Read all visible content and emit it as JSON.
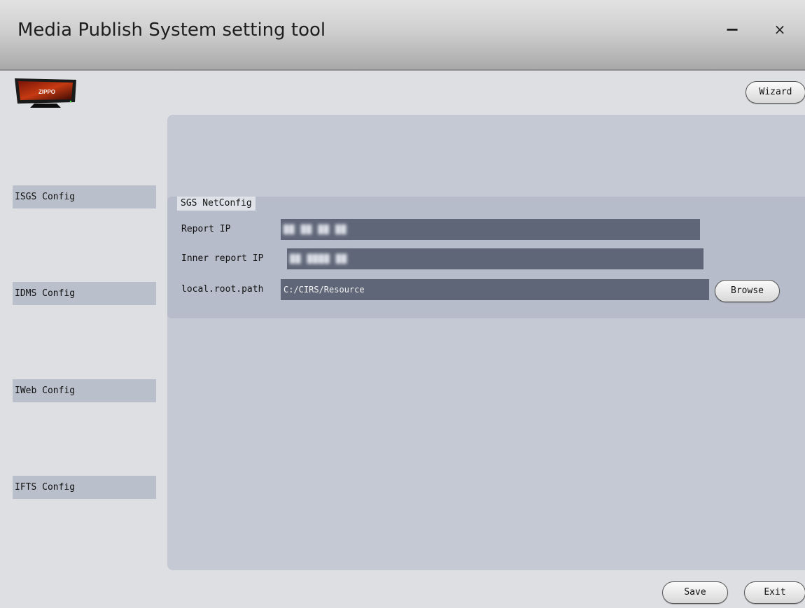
{
  "window": {
    "title": "Media Publish System setting tool",
    "minimize_glyph": "−",
    "close_glyph": "×"
  },
  "logo": {
    "icon": "monitor-logo-icon",
    "brand_text": "ZIPPO"
  },
  "header": {
    "wizard_label": "Wizard"
  },
  "sidebar": {
    "items": [
      {
        "label": "ISGS Config"
      },
      {
        "label": "IDMS Config"
      },
      {
        "label": "IWeb Config"
      },
      {
        "label": "IFTS Config"
      }
    ]
  },
  "netconfig": {
    "legend": "SGS NetConfig",
    "report_ip_label": "Report IP",
    "report_ip_value": "██ ██ ██ ██",
    "inner_report_ip_label": "Inner report IP",
    "inner_report_ip_value": "██ ████ ██",
    "root_path_label": "local.root.path",
    "root_path_value": "C:/CIRS/Resource",
    "browse_label": "Browse"
  },
  "footer": {
    "save_label": "Save",
    "exit_label": "Exit"
  },
  "colors": {
    "field_bg": "#5f6677",
    "panel_bg": "#c5c9d3",
    "group_bg": "#b6bcc9",
    "sidebar_item_bg": "#b9c0cb",
    "window_bg": "#dedfe3"
  }
}
